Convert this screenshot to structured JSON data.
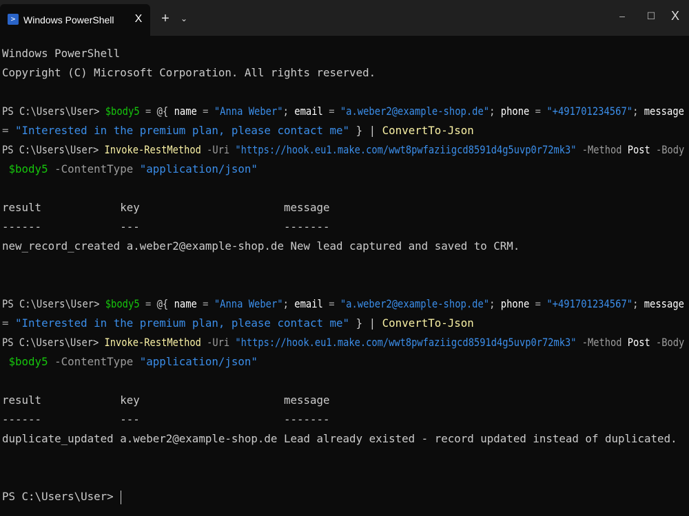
{
  "window": {
    "tab_title": "Windows PowerShell",
    "tab_close": "X",
    "new_tab": "+",
    "dropdown": "⌄",
    "minimize": "–",
    "maximize": "☐",
    "close": "X"
  },
  "terminal": {
    "header_line1": "Windows PowerShell",
    "header_line2": "Copyright (C) Microsoft Corporation. All rights reserved.",
    "prompt": "PS C:\\Users\\User> ",
    "block1": {
      "cmd1": {
        "var": "$body5",
        "op1": " = ",
        "at": "@{",
        "k_name": " name",
        "eq1": " = ",
        "v_name": "\"Anna Weber\"",
        "sep1": "; ",
        "k_email": "email",
        "eq2": " = ",
        "v_email": "\"a.weber2@example-shop.de\"",
        "sep2": "; ",
        "k_phone": "phone",
        "eq3": " = ",
        "v_phone": "\"+491701234567\"",
        "sep3": "; ",
        "k_message": "message",
        "eq4": "= ",
        "v_message": "\"Interested in the premium plan, please contact me\"",
        "close": " } ",
        "pipe": "| ",
        "convert": "ConvertTo-Json"
      },
      "cmd2": {
        "invoke": "Invoke-RestMethod",
        "uri_flag": " -Uri ",
        "url": "\"https://hook.eu1.make.com/wwt8pwfaziigcd8591d4g5uvp0r72mk3\"",
        "method_flag": " -Method ",
        "method": "Post",
        "body_flag": " -Body",
        "var": " $body5",
        "ct_flag": " -ContentType ",
        "ct": "\"application/json\""
      },
      "table": {
        "header": "result            key                      message",
        "dashes": "------            ---                      -------",
        "row": "new_record_created a.weber2@example-shop.de New lead captured and saved to CRM."
      }
    },
    "block2": {
      "table": {
        "header": "result            key                      message",
        "dashes": "------            ---                      -------",
        "row": "duplicate_updated a.weber2@example-shop.de Lead already existed - record updated instead of duplicated."
      }
    }
  }
}
